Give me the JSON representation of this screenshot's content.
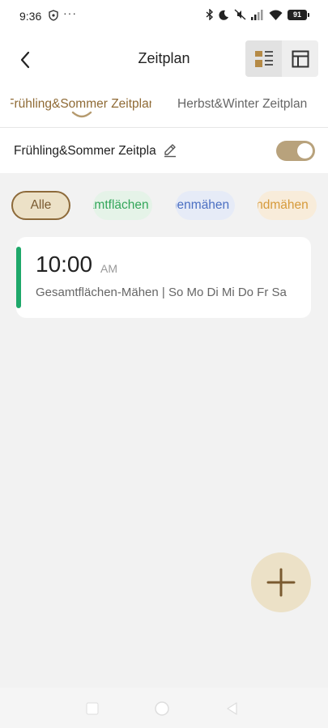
{
  "status_bar": {
    "time": "9:36",
    "dots": "···",
    "battery": "91"
  },
  "header": {
    "title": "Zeitplan",
    "back_icon": "chevron-left-icon",
    "view_list_icon": "list-view-icon",
    "view_grid_icon": "layout-view-icon"
  },
  "season_tabs": [
    {
      "label": "Frühling&Sommer Zeitplan",
      "active": true
    },
    {
      "label": "Herbst&Winter Zeitplan",
      "active": false
    }
  ],
  "plan": {
    "name": "Frühling&Sommer Zeitplan",
    "enabled": true
  },
  "filters": [
    {
      "label": "Alle",
      "selected": true
    },
    {
      "label": "Gesamtflächen",
      "selected": false
    },
    {
      "label": "Zonenmähen",
      "selected": false
    },
    {
      "label": "Randmähen",
      "selected": false
    }
  ],
  "schedule": [
    {
      "time": "10:00",
      "ampm": "AM",
      "description": "Gesamtflächen-Mähen | So Mo Di Mi Do Fr Sa",
      "color": "#1ea86a"
    }
  ],
  "fab": {
    "icon": "plus-icon"
  },
  "colors": {
    "accent": "#8f6a35",
    "accent_light": "#ece1c7",
    "green": "#33a65a",
    "blue": "#4b6fc2",
    "orange": "#d69a3a"
  }
}
